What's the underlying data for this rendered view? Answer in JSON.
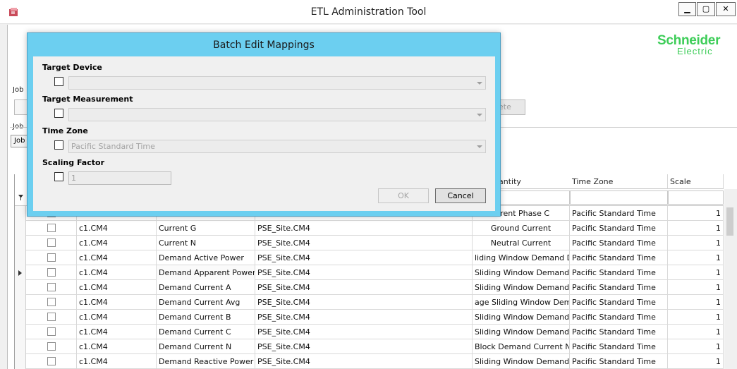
{
  "window": {
    "title": "ETL Administration Tool",
    "minimize_label": "▁",
    "maximize_label": "▢",
    "close_label": "✕"
  },
  "brand": {
    "line1": "Schneider",
    "line2": "Electric"
  },
  "background": {
    "job_label_1": "Job",
    "job_label_2": "Job",
    "job_tab": "Job",
    "button_fragment": "ete"
  },
  "grid": {
    "headers": [
      "antity",
      "Time Zone",
      "Scale"
    ],
    "rows": [
      {
        "device": "",
        "measurement": "",
        "site": "",
        "quantity": "urrent Phase C",
        "tz": "Pacific Standard Time",
        "scale": "1"
      },
      {
        "device": "c1.CM4",
        "measurement": "Current G",
        "site": "PSE_Site.CM4",
        "quantity": "Ground Current",
        "tz": "Pacific Standard Time",
        "scale": "1"
      },
      {
        "device": "c1.CM4",
        "measurement": "Current N",
        "site": "PSE_Site.CM4",
        "quantity": "Neutral Current",
        "tz": "Pacific Standard Time",
        "scale": "1"
      },
      {
        "device": "c1.CM4",
        "measurement": "Demand Active Power",
        "site": "PSE_Site.CM4",
        "quantity": "liding Window Demand Deliv",
        "tz": "Pacific Standard Time",
        "scale": "1"
      },
      {
        "device": "c1.CM4",
        "measurement": "Demand Apparent Power",
        "site": "PSE_Site.CM4",
        "quantity": "Sliding Window Demand Del",
        "tz": "Pacific Standard Time",
        "scale": "1"
      },
      {
        "device": "c1.CM4",
        "measurement": "Demand Current A",
        "site": "PSE_Site.CM4",
        "quantity": "Sliding Window Demand Del",
        "tz": "Pacific Standard Time",
        "scale": "1"
      },
      {
        "device": "c1.CM4",
        "measurement": "Demand Current Avg",
        "site": "PSE_Site.CM4",
        "quantity": "age Sliding Window Demand",
        "tz": "Pacific Standard Time",
        "scale": "1"
      },
      {
        "device": "c1.CM4",
        "measurement": "Demand Current B",
        "site": "PSE_Site.CM4",
        "quantity": "Sliding Window Demand Del",
        "tz": "Pacific Standard Time",
        "scale": "1"
      },
      {
        "device": "c1.CM4",
        "measurement": "Demand Current C",
        "site": "PSE_Site.CM4",
        "quantity": "Sliding Window Demand Del",
        "tz": "Pacific Standard Time",
        "scale": "1"
      },
      {
        "device": "c1.CM4",
        "measurement": "Demand Current N",
        "site": "PSE_Site.CM4",
        "quantity": "Block Demand Current N",
        "tz": "Pacific Standard Time",
        "scale": "1"
      },
      {
        "device": "c1.CM4",
        "measurement": "Demand Reactive Power",
        "site": "PSE_Site.CM4",
        "quantity": "Sliding Window Demand Deliv",
        "tz": "Pacific Standard Time",
        "scale": "1"
      }
    ]
  },
  "dialog": {
    "title": "Batch Edit Mappings",
    "target_device_label": "Target Device",
    "target_device_value": "",
    "target_measurement_label": "Target Measurement",
    "target_measurement_value": "",
    "time_zone_label": "Time Zone",
    "time_zone_value": "Pacific Standard Time",
    "scaling_factor_label": "Scaling Factor",
    "scaling_factor_value": "1",
    "ok_label": "OK",
    "cancel_label": "Cancel"
  }
}
